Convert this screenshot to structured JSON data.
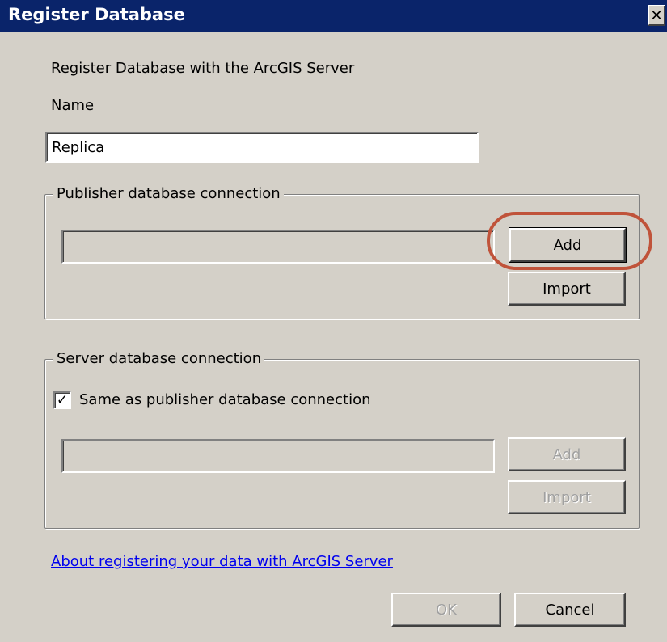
{
  "window": {
    "title": "Register Database",
    "close_glyph": "✕"
  },
  "intro_text": "Register Database with the ArcGIS Server",
  "name_field": {
    "label": "Name",
    "value": "Replica"
  },
  "publisher_group": {
    "label": "Publisher database connection",
    "connection_value": "",
    "add_label": "Add",
    "import_label": "Import",
    "highlight_color": "#c0533a"
  },
  "server_group": {
    "label": "Server database connection",
    "same_as_publisher_label": "Same as publisher database connection",
    "same_as_publisher_checked": true,
    "connection_value": "",
    "add_label": "Add",
    "import_label": "Import"
  },
  "help_link": "About registering your data with ArcGIS Server",
  "footer": {
    "ok_label": "OK",
    "cancel_label": "Cancel"
  },
  "colors": {
    "title_bar": "#0a246a",
    "dialog_bg": "#d4d0c8",
    "link": "#0000ee"
  }
}
